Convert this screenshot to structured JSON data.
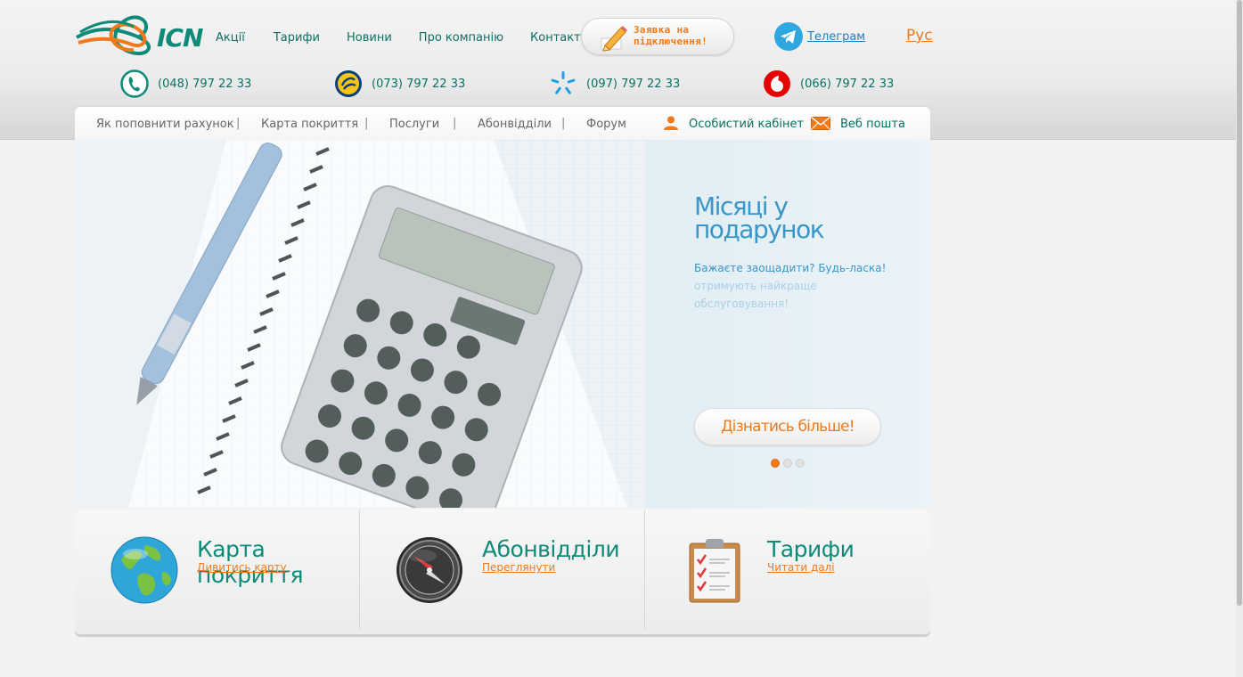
{
  "brand": {
    "logo_text": "ICN",
    "accent": "#f07a1a",
    "primary": "#0d8b78"
  },
  "main_nav": [
    "Акції",
    "Тарифи",
    "Новини",
    "Про компанію",
    "Контакти"
  ],
  "apply_button": {
    "label": "Заявка на підключення!",
    "icon": "pencil-icon"
  },
  "telegram": {
    "label": "Телеграм",
    "icon": "telegram-icon"
  },
  "language": "Рус",
  "phones": [
    {
      "number": "(048) 797 22 33",
      "icon": "phone-icon"
    },
    {
      "number": "(073) 797 22 33",
      "icon": "lifecell-icon"
    },
    {
      "number": "(097) 797 22 33",
      "icon": "kyivstar-icon"
    },
    {
      "number": "(066) 797 22 33",
      "icon": "vodafone-icon"
    }
  ],
  "sub_nav": {
    "items": [
      "Як поповнити рахунок",
      "Карта покриття",
      "Послуги",
      "Абонвідділи",
      "Форум"
    ],
    "separator": "|",
    "cabinet": "Особистий кабінет",
    "webmail": "Веб пошта"
  },
  "slider": {
    "title": "Місяці у подарунок",
    "description": "Бажаєте заощадити? Будь-ласка!",
    "description_ghost": "отримують найкраще обслуговування!",
    "button": "Дізнатись більше!",
    "dots": 3,
    "active_dot": 0
  },
  "blocks": [
    {
      "title": "Карта покриття",
      "link": "Дивитись карту",
      "icon": "globe-icon"
    },
    {
      "title": "Абонвідділи",
      "link": "Переглянути",
      "icon": "compass-icon"
    },
    {
      "title": "Тарифи",
      "link": "Читати далі",
      "icon": "clipboard-icon"
    }
  ]
}
